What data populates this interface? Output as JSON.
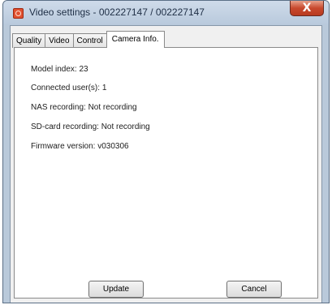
{
  "window": {
    "title": "Video settings - 002227147 / 002227147",
    "close_label": "X"
  },
  "tabs": [
    {
      "label": "Quality",
      "active": false
    },
    {
      "label": "Video",
      "active": false
    },
    {
      "label": "Control",
      "active": false
    },
    {
      "label": "Camera Info.",
      "active": true
    }
  ],
  "camera_info": {
    "model_index": "Model index: 23",
    "connected_users": "Connected user(s): 1",
    "nas_recording": "NAS recording: Not recording",
    "sd_recording": "SD-card recording: Not recording",
    "firmware": "Firmware version: v030306"
  },
  "buttons": {
    "update": "Update",
    "cancel": "Cancel"
  },
  "colors": {
    "frame": "#b9c9da",
    "close_button": "#c8492e",
    "panel": "#ffffff"
  }
}
